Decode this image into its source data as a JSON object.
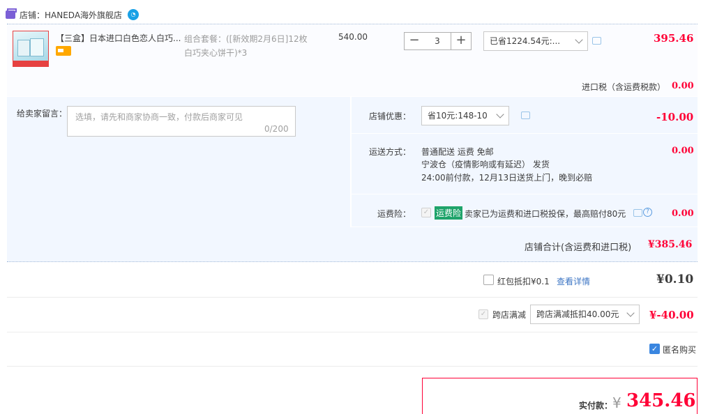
{
  "shop": {
    "label": "店铺：HANEDA海外旗舰店"
  },
  "item": {
    "title": "【三盒】日本进口白色恋人白巧...",
    "sku_line1": "组合套餐：([新效期2月6日]12枚",
    "sku_line2": "白巧夹心饼干)*3",
    "price": "540.00",
    "quantity": "3",
    "minus": "−",
    "plus": "+",
    "saved": "已省1224.54元:...",
    "total": "395.46"
  },
  "tax": {
    "label": "进口税（含运费税款）",
    "value": "0.00"
  },
  "memo": {
    "label": "给卖家留言：",
    "placeholder": "选填，请先和商家协商一致，付款后商家可见",
    "count": "0/200"
  },
  "promo": {
    "label": "店铺优惠：",
    "selected": "省10元:148-10",
    "value": "-10.00"
  },
  "shipping": {
    "label": "运送方式：",
    "line1": "普通配送 运费 免邮",
    "line2": "宁波仓（疫情影响或有延迟）  发货",
    "line3": "24:00前付款，12月13日送货上门，晚到必赔",
    "value": "0.00"
  },
  "insurance": {
    "label": "运费险：",
    "badge": "运费险",
    "text": "卖家已为运费和进口税投保，最高赔付80元",
    "help": "?",
    "value": "0.00"
  },
  "shop_total": {
    "label": "店铺合计(含运费和进口税)",
    "value": "¥385.46"
  },
  "red_packet": {
    "label": "红包抵扣¥0.1",
    "link": "查看详情",
    "value": "¥0.10"
  },
  "cross_store": {
    "label": "跨店满减",
    "selected": "跨店满减抵扣40.00元",
    "value": "¥-40.00"
  },
  "anonymous": {
    "label": "匿名购买",
    "check": "✓"
  },
  "payment": {
    "label": "实付款：",
    "currency": "¥",
    "value": "345.46"
  },
  "colors": {
    "accent_red": "#ff0036",
    "section_bg": "#f2f7ff",
    "link_blue": "#3d76c4",
    "insurance_green": "#1ea36a"
  }
}
